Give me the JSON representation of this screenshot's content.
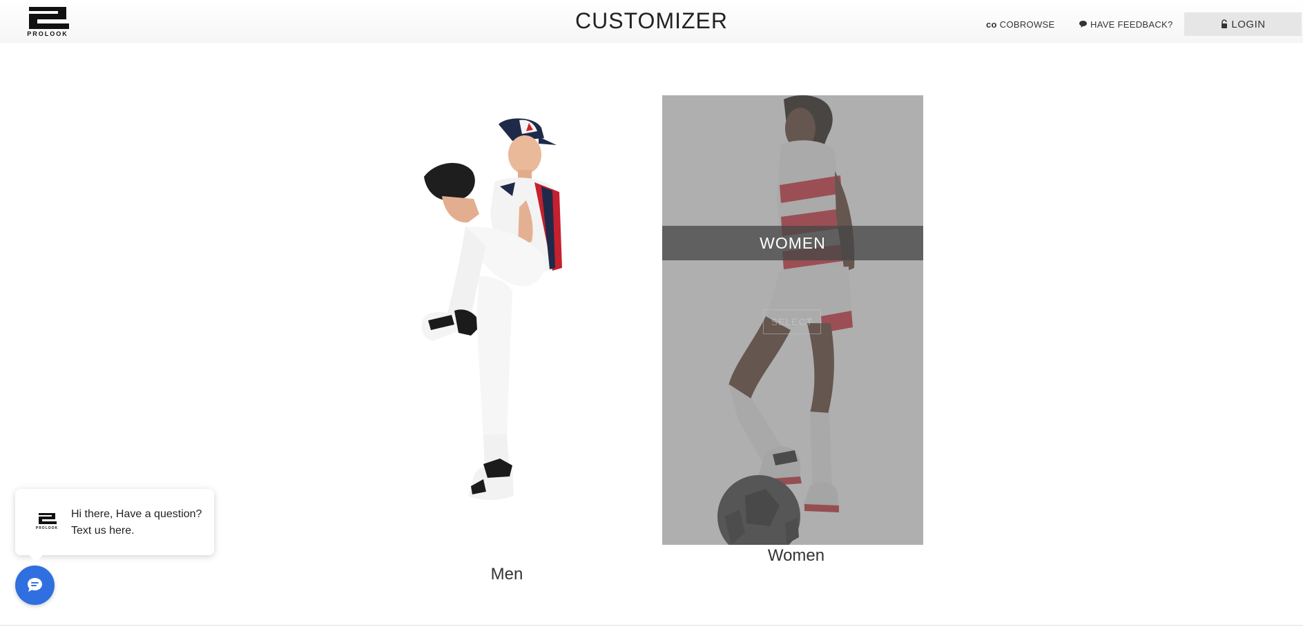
{
  "header": {
    "logo_text": "PROLOOK",
    "title": "CUSTOMIZER",
    "nav": {
      "cobrowse_icon": "co",
      "cobrowse_label": "COBROWSE",
      "feedback_label": "HAVE FEEDBACK?",
      "login_label": "LOGIN"
    }
  },
  "cards": {
    "men": {
      "caption": "Men"
    },
    "women": {
      "caption": "Women",
      "overlay_label": "WOMEN",
      "select_label": "SELECT"
    }
  },
  "chat": {
    "logo_text": "PROLOOK",
    "message": "Hi there, Have a question? Text us here."
  },
  "icons": {
    "feedback": "speech-bubble-icon",
    "login": "lock-icon",
    "chat": "chat-icon"
  }
}
